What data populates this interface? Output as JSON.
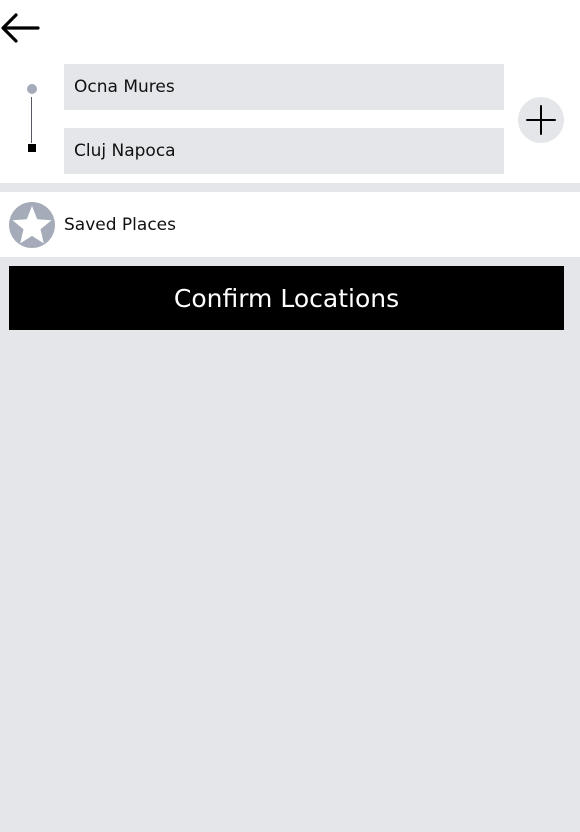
{
  "header": {
    "back_icon": "arrow-left-icon"
  },
  "route": {
    "origin": "Ocna Mures",
    "destination": "Cluj Napoca",
    "add_stop_icon": "plus-icon"
  },
  "saved_places": {
    "label": "Saved Places",
    "icon": "star-icon"
  },
  "actions": {
    "confirm_label": "Confirm Locations"
  },
  "colors": {
    "background": "#e5e6ea",
    "surface": "#ffffff",
    "primary_button": "#000000",
    "primary_button_text": "#ffffff",
    "route_origin_dot": "#a5abb8",
    "route_destination_square": "#000000",
    "star_icon_fill": "#a5abb8"
  }
}
